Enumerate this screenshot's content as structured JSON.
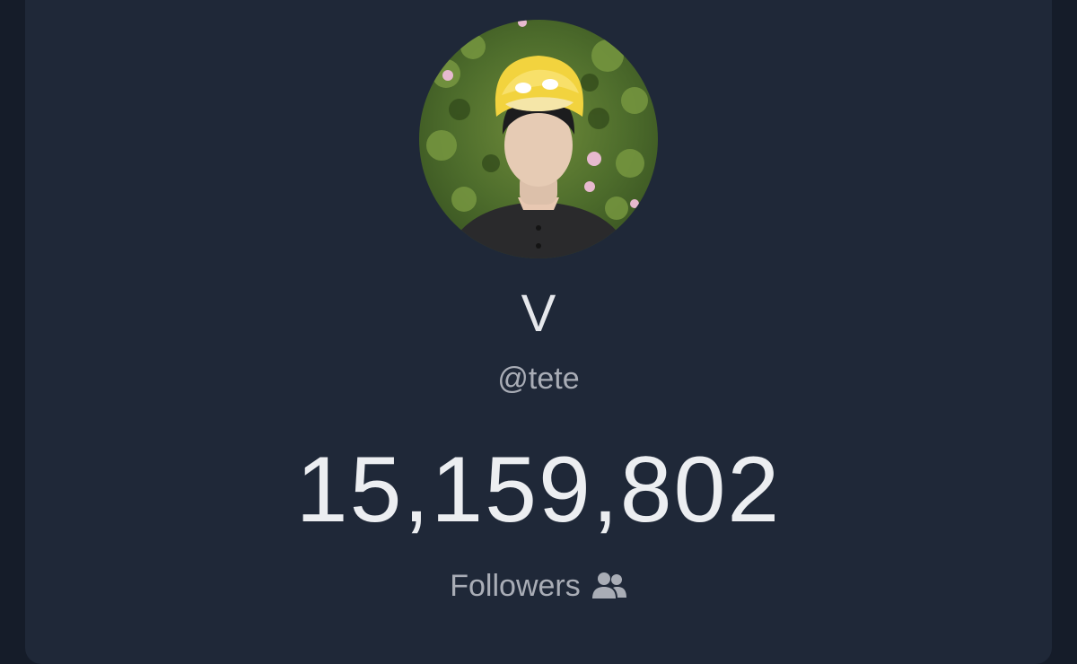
{
  "profile": {
    "display_name": "V",
    "handle": "@tete",
    "avatar_icon": "profile-photo"
  },
  "stats": {
    "followers_count": "15,159,802",
    "followers_label": "Followers",
    "followers_icon": "people-icon"
  },
  "colors": {
    "background": "#151c29",
    "card": "#1f2838",
    "primary_text": "#eceef1",
    "secondary_text": "#a9adb6"
  }
}
